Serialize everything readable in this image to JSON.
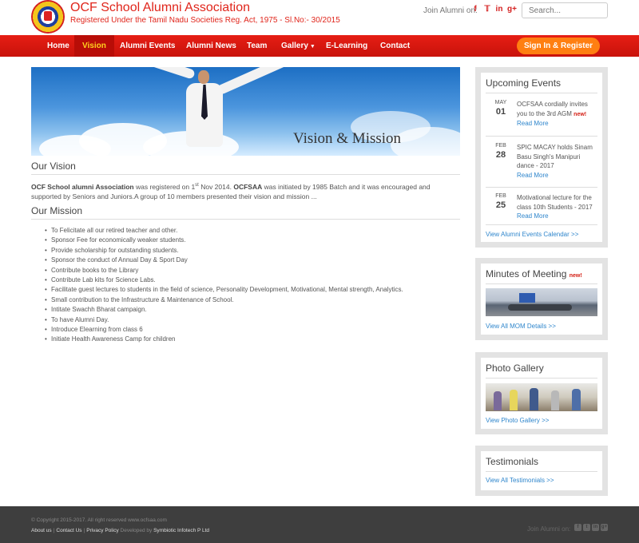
{
  "header": {
    "title": "OCF School Alumni Association",
    "subtitle": "Registered Under the Tamil Nadu Societies Reg. Act, 1975 - Sl.No:- 30/2015",
    "join_label": "Join Alumni on:",
    "social": [
      "f",
      "t",
      "in",
      "g+"
    ],
    "search_placeholder": "Search..."
  },
  "nav": {
    "items": [
      {
        "label": "Home"
      },
      {
        "label": "Vision",
        "active": true
      },
      {
        "label": "Alumni Events"
      },
      {
        "label": "Alumni News"
      },
      {
        "label": "Team"
      },
      {
        "label": "Gallery"
      },
      {
        "label": "E-Learning"
      },
      {
        "label": "Contact"
      }
    ],
    "signin_label": "Sign In & Register"
  },
  "banner": {
    "text": "Vision & Mission"
  },
  "vision": {
    "heading": "Our Vision",
    "org_name": "OCF School alumni Association",
    "text1": " was registered on 1",
    "sup": "st",
    "text2": " Nov 2014. ",
    "abbr": "OCFSAA",
    "text3": " was initiated by 1985 Batch and it was encouraged and supported by Seniors and Juniors.A group of 10 members presented their vision and mission ..."
  },
  "mission": {
    "heading": "Our Mission",
    "items": [
      "To Felicitate all our retired teacher and other.",
      "Sponsor Fee for economically weaker students.",
      "Provide scholarship for outstanding students.",
      "Sponsor the conduct of Annual Day & Sport Day",
      "Contribute books to the Library",
      "Contribute Lab kits for Science Labs.",
      "Facilitate guest lectures to students in the field of science, Personality Development, Motivational, Mental strength, Analytics.",
      "Small contribution to the Infrastructure & Maintenance of School.",
      "Intitate Swachh Bharat campaign.",
      "To have Alumni Day.",
      "Introduce Elearning from class 6",
      "Initiate Health Awareness Camp for children"
    ]
  },
  "sidebar": {
    "events": {
      "title": "Upcoming Events",
      "items": [
        {
          "month": "MAY",
          "day": "01",
          "text": "OCFSAA cordially invites you to the 3rd AGM",
          "new": "new!",
          "more": "Read More"
        },
        {
          "month": "FEB",
          "day": "28",
          "text": "SPIC MACAY holds Sinam Basu Singh's Manipuri dance - 2017",
          "new": "",
          "more": "Read More"
        },
        {
          "month": "FEB",
          "day": "25",
          "text": "Motivational lecture for the class 10th Students - 2017",
          "new": "",
          "more": "Read More"
        }
      ],
      "link": "View Alumni Events Calendar >>"
    },
    "minutes": {
      "title": "Minutes of Meeting",
      "new": "new!",
      "link": "View All MOM Details >>"
    },
    "gallery": {
      "title": "Photo Gallery",
      "link": "View Photo Gallery >>"
    },
    "testimonials": {
      "title": "Testimonials",
      "link": "View All Testimonials >>"
    }
  },
  "footer": {
    "copyright": "© Copyright 2015-2017. All right reserved www.ocfsaa.com",
    "about": "About us",
    "contact": "Contact Us",
    "privacy": "Privacy Policy",
    "developed": "Developed by",
    "developer": "Symbiotic Infotech P Ltd",
    "join_label": "Join Alumni on:",
    "social": [
      "f",
      "t",
      "in",
      "g+"
    ]
  },
  "colors": {
    "brand_red": "#e0251b",
    "nav_active_text": "#ffd21f",
    "signin_orange": "#ff7f11",
    "link_blue": "#2f86cc"
  }
}
